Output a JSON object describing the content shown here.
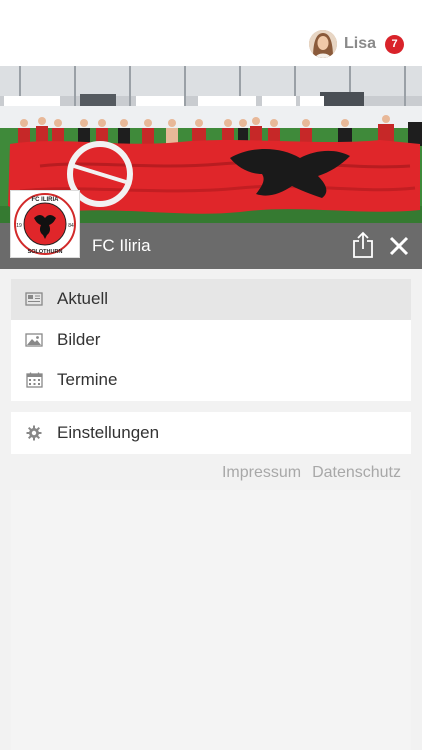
{
  "header": {
    "user_name": "Lisa",
    "notification_count": "7"
  },
  "club": {
    "name": "FC Iliria",
    "logo_text_top": "FC ILIRIA",
    "logo_text_bottom": "SOLOTHURN",
    "logo_year_left": "19",
    "logo_year_right": "84"
  },
  "menu": {
    "items": [
      {
        "label": "Aktuell",
        "icon": "newspaper-icon",
        "active": true
      },
      {
        "label": "Bilder",
        "icon": "image-icon",
        "active": false
      },
      {
        "label": "Termine",
        "icon": "calendar-icon",
        "active": false
      }
    ],
    "settings": {
      "label": "Einstellungen",
      "icon": "gear-icon"
    }
  },
  "footer": {
    "impressum": "Impressum",
    "datenschutz": "Datenschutz"
  },
  "colors": {
    "badge": "#d9232a",
    "teambar": "#6b6b6b",
    "active_item": "#e6e6e6",
    "flag_red": "#e0262a"
  }
}
